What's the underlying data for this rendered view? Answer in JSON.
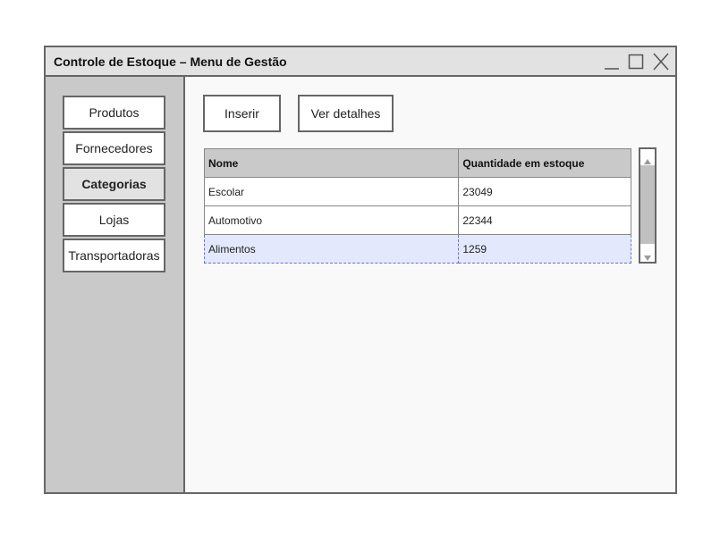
{
  "window": {
    "title": "Controle de Estoque – Menu de Gestão"
  },
  "sidebar": {
    "items": [
      {
        "label": "Produtos",
        "active": false
      },
      {
        "label": "Fornecedores",
        "active": false
      },
      {
        "label": "Categorias",
        "active": true
      },
      {
        "label": "Lojas",
        "active": false
      },
      {
        "label": "Transportadoras",
        "active": false
      }
    ]
  },
  "toolbar": {
    "insert_label": "Inserir",
    "details_label": "Ver detalhes"
  },
  "table": {
    "columns": [
      "Nome",
      "Quantidade em estoque"
    ],
    "rows": [
      {
        "nome": "Escolar",
        "quantidade": "23049"
      },
      {
        "nome": "Automotivo",
        "quantidade": "22344"
      },
      {
        "nome": "Alimentos",
        "quantidade": "1259",
        "selected": true
      }
    ]
  },
  "icons": {
    "minimize": "minimize-icon",
    "maximize": "maximize-icon",
    "close": "close-icon",
    "scroll_up": "chevron-up-icon",
    "scroll_down": "chevron-down-icon"
  },
  "colors": {
    "sidebar_bg": "#c9c9c9",
    "titlebar_bg": "#e2e2e2",
    "selection_bg": "#e3e8fc",
    "selection_border": "#6b72d8"
  }
}
